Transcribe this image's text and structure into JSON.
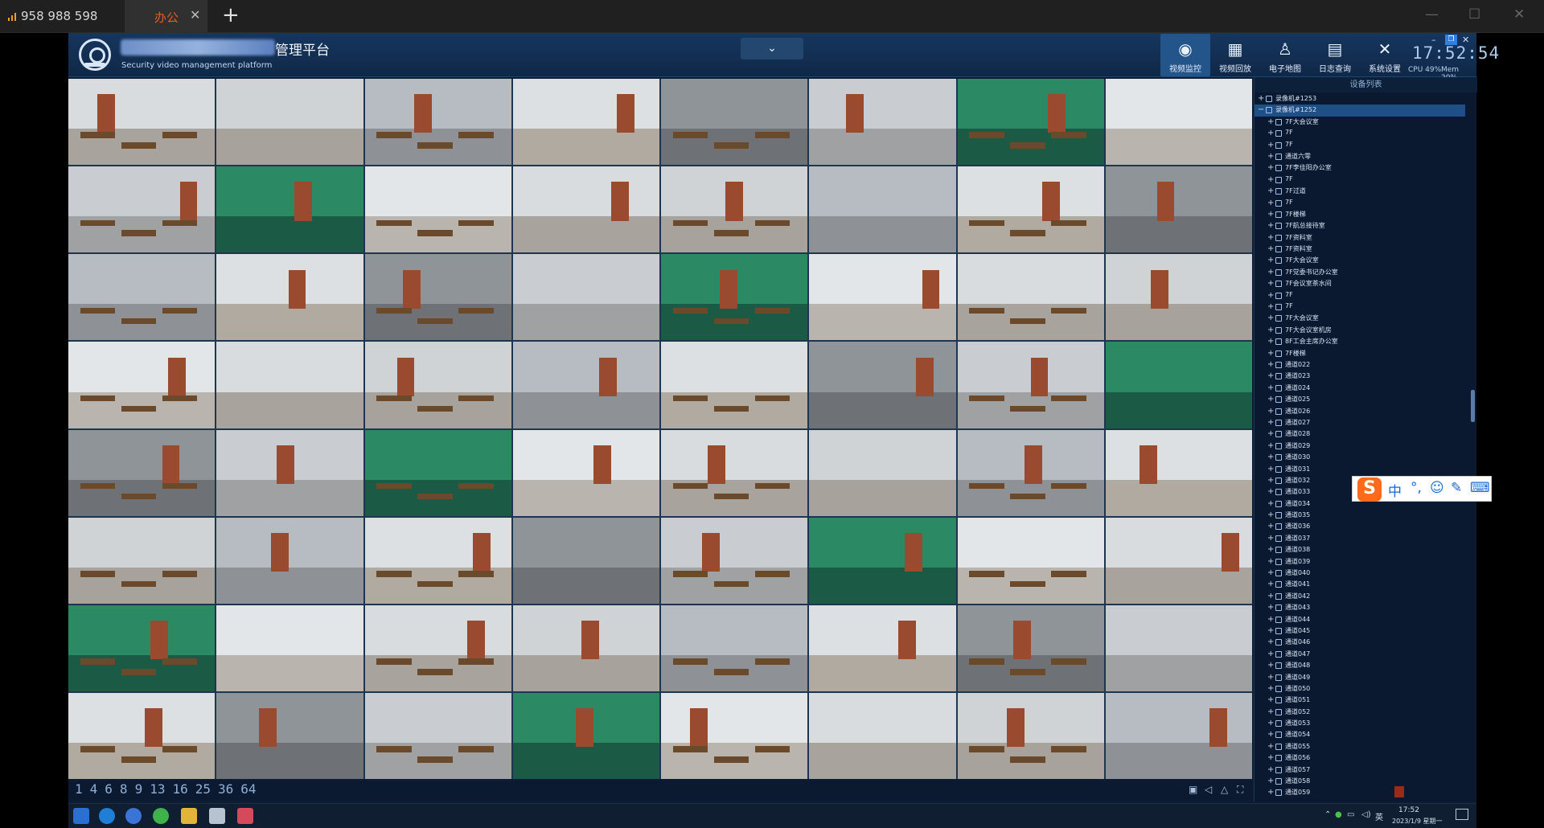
{
  "outer": {
    "conn_id": "958 988 598",
    "tab_title": "办公",
    "tab_close": "✕",
    "new_tab": "+",
    "minimize": "—",
    "maximize": "☐",
    "close": "✕"
  },
  "app": {
    "title": "管理平台",
    "subtitle": "Security video management platform",
    "dropdown_glyph": "⌄",
    "nav": [
      {
        "label": "视频监控",
        "icon": "camera-icon",
        "glyph": "◉"
      },
      {
        "label": "视频回放",
        "icon": "film-icon",
        "glyph": "▦"
      },
      {
        "label": "电子地图",
        "icon": "map-person-icon",
        "glyph": "♙"
      },
      {
        "label": "日志查询",
        "icon": "log-book-icon",
        "glyph": "▤"
      },
      {
        "label": "系统设置",
        "icon": "tools-icon",
        "glyph": "✕"
      }
    ],
    "clock": "17:52:54",
    "cpu": "CPU 49%",
    "mem": "Mem 20%",
    "mini_min": "–",
    "mini_close": "✕",
    "mini_restore": "❐"
  },
  "layouts": [
    "1",
    "4",
    "6",
    "8",
    "9",
    "13",
    "16",
    "25",
    "36",
    "64"
  ],
  "tools": [
    "▣",
    "◁",
    "△",
    "⛶"
  ],
  "panel": {
    "title": "设备列表",
    "root": [
      {
        "label": "录像机#1253",
        "expander": "+",
        "selected": false
      },
      {
        "label": "录像机#1252",
        "expander": "−",
        "selected": true
      }
    ],
    "channels": [
      "7F大会议室",
      "7F",
      "7F",
      "通道六零",
      "7F李佳阳办公室",
      "7F",
      "7F过道",
      "7F",
      "7F楼梯",
      "7F航总接待室",
      "7F资料室",
      "7F资料室",
      "7F大会议室",
      "7F党委书记办公室",
      "7F会议室茶水间",
      "7F",
      "7F",
      "7F大会议室",
      "7F大会议室机房",
      "8F工会主席办公室",
      "7F楼梯",
      "通道022",
      "通道023",
      "通道024",
      "通道025",
      "通道026",
      "通道027",
      "通道028",
      "通道029",
      "通道030",
      "通道031",
      "通道032",
      "通道033",
      "通道034",
      "通道035",
      "通道036",
      "通道037",
      "通道038",
      "通道039",
      "通道040",
      "通道041",
      "通道042",
      "通道043",
      "通道044",
      "通道045",
      "通道046",
      "通道047",
      "通道048",
      "通道049",
      "通道050",
      "通道051",
      "通道052",
      "通道053",
      "通道054",
      "通道055",
      "通道056",
      "通道057",
      "通道058",
      "通道059"
    ]
  },
  "ime": {
    "logo": "S",
    "items": [
      "中",
      "°,",
      "☺",
      "✎",
      "⌨"
    ]
  },
  "taskbar": {
    "time": "17:52",
    "date": "2023/1/9 星期一",
    "lang": "英",
    "sys_icons": [
      "⌃",
      "●",
      "▭",
      "◁)"
    ]
  }
}
